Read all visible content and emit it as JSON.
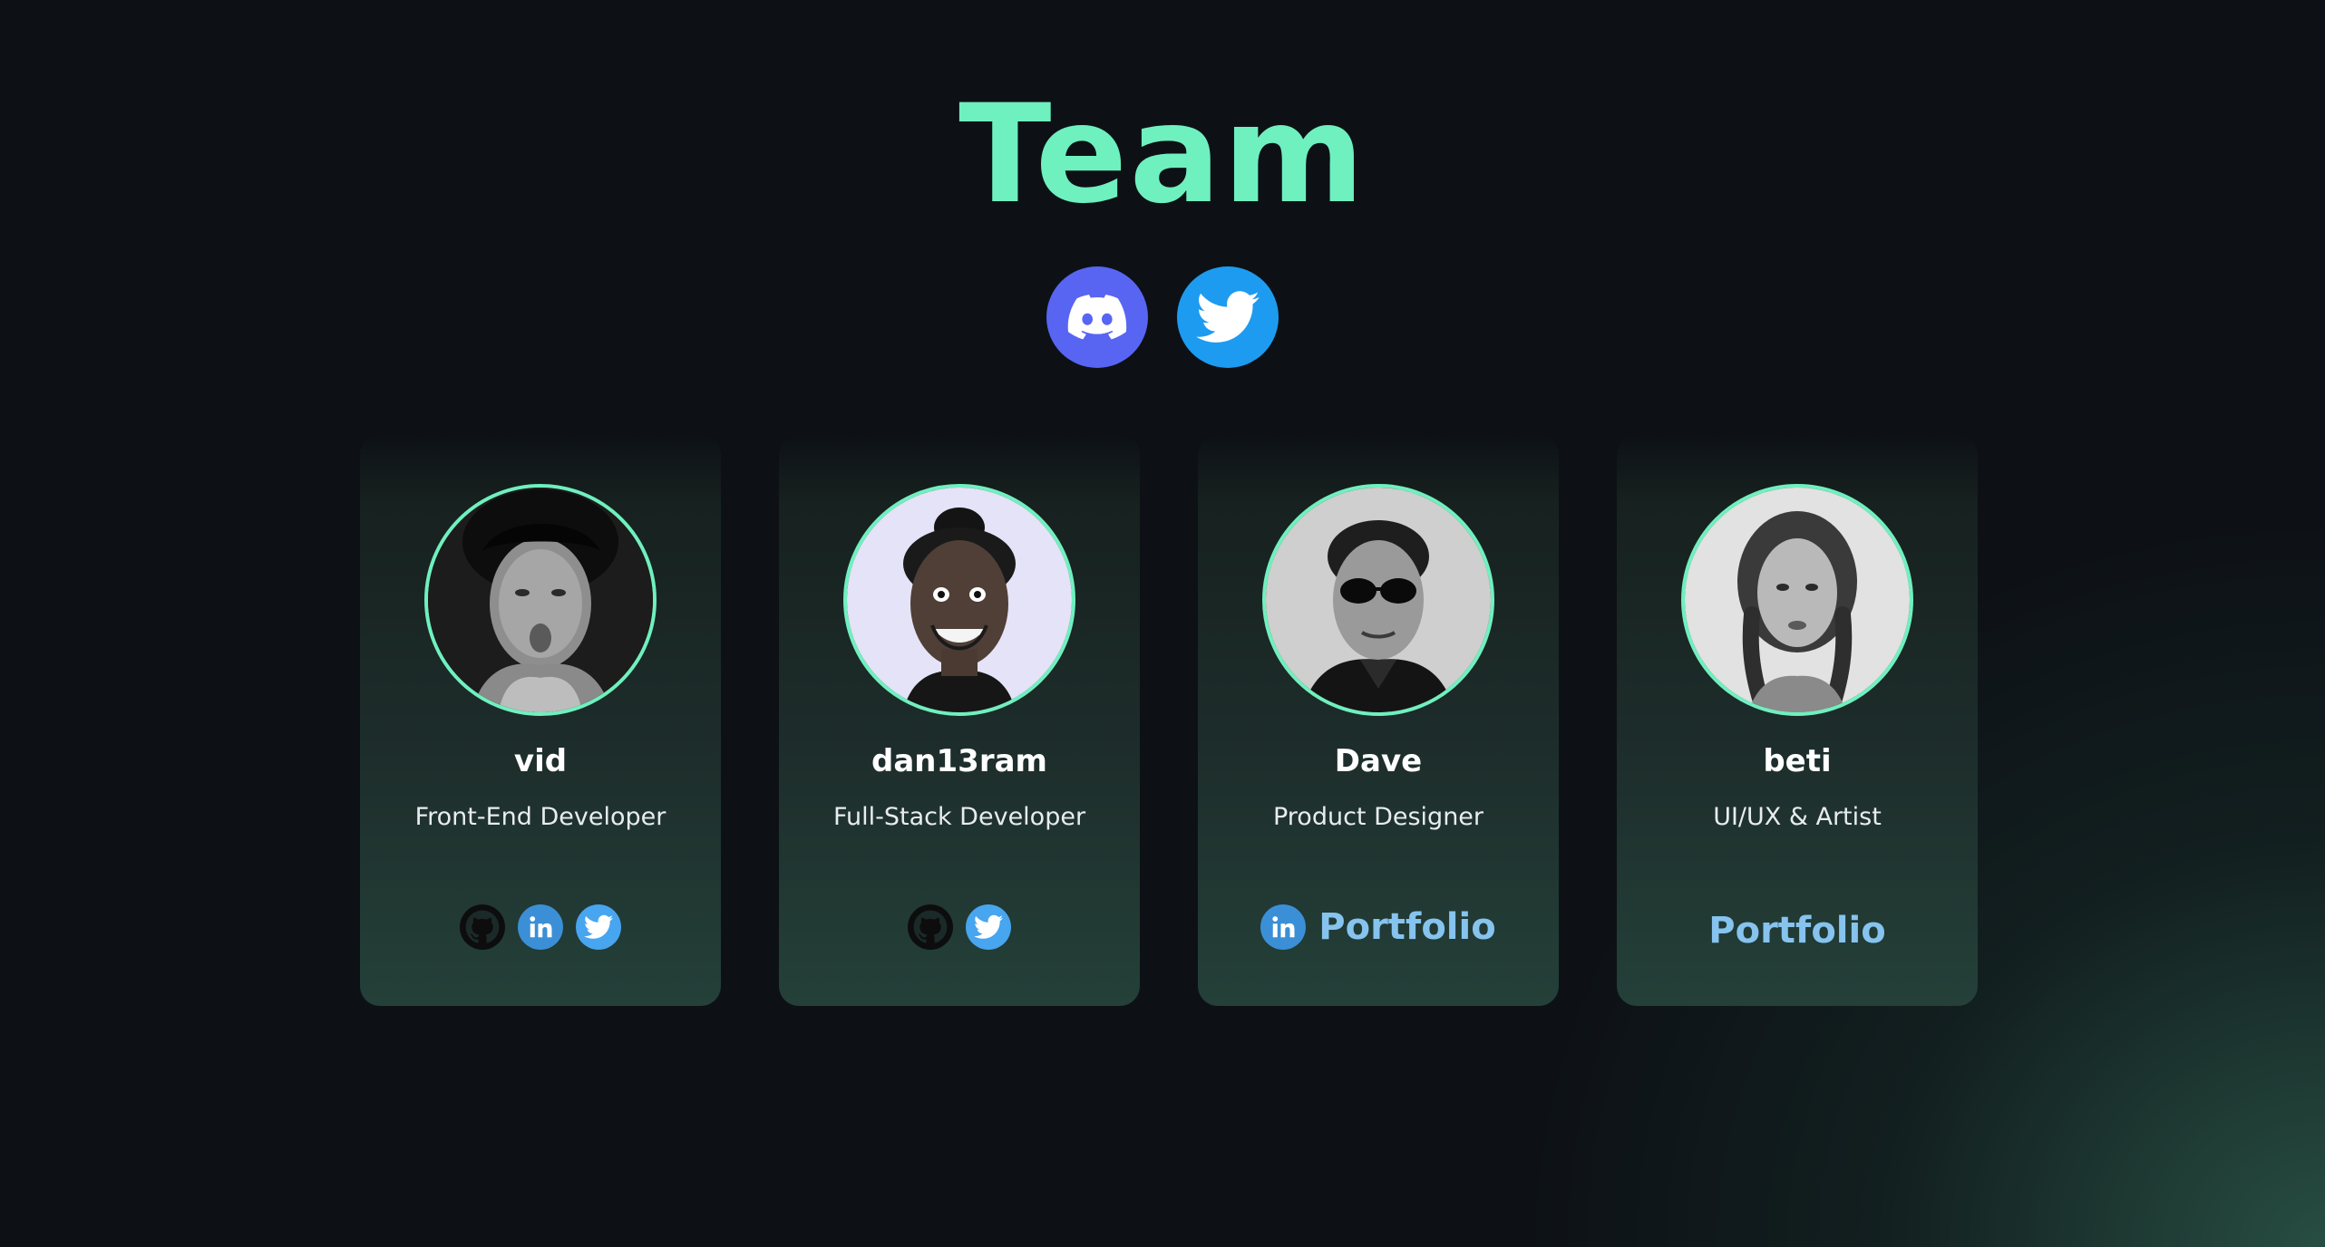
{
  "page": {
    "title": "Team"
  },
  "community": {
    "discord_icon": "discord-icon",
    "twitter_icon": "twitter-icon"
  },
  "members": [
    {
      "name": "vid",
      "role": "Front-End Developer",
      "links": [
        "github-icon",
        "linkedin-icon",
        "twitter-icon"
      ]
    },
    {
      "name": "dan13ram",
      "role": "Full-Stack Developer",
      "links": [
        "github-icon",
        "twitter-icon"
      ]
    },
    {
      "name": "Dave",
      "role": "Product Designer",
      "links": [
        "linkedin-icon"
      ],
      "portfolio_label": "Portfolio"
    },
    {
      "name": "beti",
      "role": "UI/UX & Artist",
      "links": [],
      "portfolio_label": "Portfolio"
    }
  ],
  "colors": {
    "accent": "#6ff0bf",
    "background": "#0d1116",
    "discord": "#5865f2",
    "twitter": "#1d9bf0",
    "linkedin": "#3b8fd6",
    "portfolio_link": "#86c3ee"
  }
}
